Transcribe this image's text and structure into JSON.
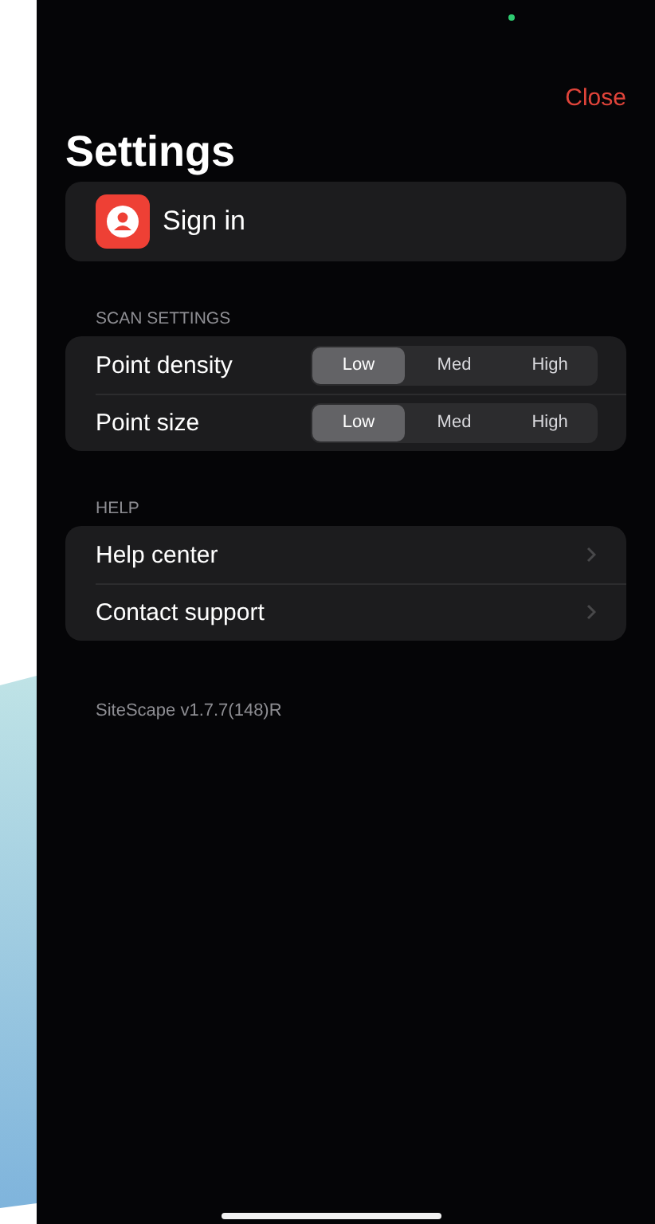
{
  "close": "Close",
  "title": "Settings",
  "account": {
    "label": "Sign in"
  },
  "sections": [
    {
      "header": "SCAN SETTINGS",
      "rows": [
        {
          "kind": "segmented",
          "label": "Point density",
          "options": [
            {
              "label": "Low",
              "selected": true
            },
            {
              "label": "Med",
              "selected": false
            },
            {
              "label": "High",
              "selected": false
            }
          ]
        },
        {
          "kind": "segmented",
          "label": "Point size",
          "options": [
            {
              "label": "Low",
              "selected": true
            },
            {
              "label": "Med",
              "selected": false
            },
            {
              "label": "High",
              "selected": false
            }
          ]
        }
      ]
    },
    {
      "header": "HELP",
      "rows": [
        {
          "kind": "link",
          "label": "Help center"
        },
        {
          "kind": "link",
          "label": "Contact support"
        }
      ]
    }
  ],
  "version": "SiteScape v1.7.7(148)R"
}
